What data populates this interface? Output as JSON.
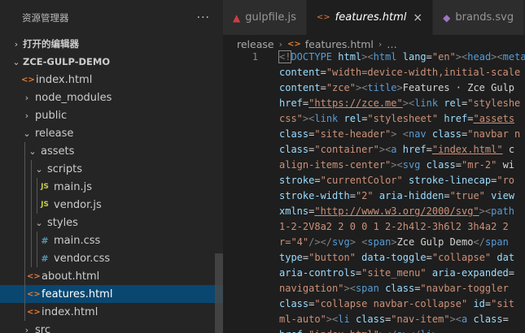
{
  "explorer": {
    "title": "资源管理器",
    "more": "···",
    "open_editors": "打开的编辑器",
    "project": "ZCE-GULP-DEMO",
    "tree": [
      {
        "label": "index.html",
        "icon": "<>",
        "type": "html",
        "depth": 1
      },
      {
        "label": "node_modules",
        "chev": "›",
        "depth": 1
      },
      {
        "label": "public",
        "chev": "›",
        "depth": 1
      },
      {
        "label": "release",
        "chev": "⌄",
        "depth": 1
      },
      {
        "label": "assets",
        "chev": "⌄",
        "depth": 2
      },
      {
        "label": "scripts",
        "chev": "⌄",
        "depth": 3
      },
      {
        "label": "main.js",
        "icon": "JS",
        "type": "js",
        "depth": 4
      },
      {
        "label": "vendor.js",
        "icon": "JS",
        "type": "js",
        "depth": 4
      },
      {
        "label": "styles",
        "chev": "⌄",
        "depth": 3
      },
      {
        "label": "main.css",
        "icon": "#",
        "type": "css",
        "depth": 4
      },
      {
        "label": "vendor.css",
        "icon": "#",
        "type": "css",
        "depth": 4
      },
      {
        "label": "about.html",
        "icon": "<>",
        "type": "html",
        "depth": 2
      },
      {
        "label": "features.html",
        "icon": "<>",
        "type": "html",
        "depth": 2,
        "selected": true
      },
      {
        "label": "index.html",
        "icon": "<>",
        "type": "html",
        "depth": 2
      },
      {
        "label": "src",
        "chev": "›",
        "depth": 1
      }
    ]
  },
  "tabs": [
    {
      "label": "gulpfile.js",
      "icon": "gulp-icon",
      "glyph": "▲",
      "active": false
    },
    {
      "label": "features.html",
      "icon": "html-icon",
      "glyph": "<>",
      "active": true,
      "close": "×"
    },
    {
      "label": "brands.svg",
      "icon": "svg-icon",
      "glyph": "◆",
      "active": false
    }
  ],
  "breadcrumb": {
    "folder": "release",
    "file": "features.html",
    "more": "…",
    "sep": "›"
  },
  "code": {
    "line_number": "1",
    "lines": [
      [
        [
          "p",
          "<!"
        ],
        [
          "t",
          "DOCTYPE "
        ],
        [
          "a",
          "html"
        ],
        [
          "p",
          ">"
        ],
        [
          "p",
          "<"
        ],
        [
          "t",
          "html "
        ],
        [
          "a",
          "lang"
        ],
        [
          "x",
          "="
        ],
        [
          "s",
          "\"en\""
        ],
        [
          "p",
          ">"
        ],
        [
          "p",
          "<"
        ],
        [
          "t",
          "head"
        ],
        [
          "p",
          ">"
        ],
        [
          "p",
          "<"
        ],
        [
          "t",
          "meta"
        ]
      ],
      [
        [
          "a",
          "content"
        ],
        [
          "x",
          "="
        ],
        [
          "s",
          "\"width=device-width,initial-scale"
        ]
      ],
      [
        [
          "a",
          "content"
        ],
        [
          "x",
          "="
        ],
        [
          "s",
          "\"zce\""
        ],
        [
          "p",
          ">"
        ],
        [
          "p",
          "<"
        ],
        [
          "t",
          "title"
        ],
        [
          "p",
          ">"
        ],
        [
          "x",
          "Features · Zce Gulp"
        ]
      ],
      [
        [
          "a",
          "href"
        ],
        [
          "x",
          "="
        ],
        [
          "u",
          "\"https://zce.me\""
        ],
        [
          "p",
          ">"
        ],
        [
          "p",
          "<"
        ],
        [
          "t",
          "link "
        ],
        [
          "a",
          "rel"
        ],
        [
          "x",
          "="
        ],
        [
          "s",
          "\"styleshe"
        ]
      ],
      [
        [
          "s",
          "css\""
        ],
        [
          "p",
          ">"
        ],
        [
          "p",
          "<"
        ],
        [
          "t",
          "link "
        ],
        [
          "a",
          "rel"
        ],
        [
          "x",
          "="
        ],
        [
          "s",
          "\"stylesheet\" "
        ],
        [
          "a",
          "href"
        ],
        [
          "x",
          "="
        ],
        [
          "u",
          "\"assets"
        ]
      ],
      [
        [
          "a",
          "class"
        ],
        [
          "x",
          "="
        ],
        [
          "s",
          "\"site-header\""
        ],
        [
          "p",
          "> <"
        ],
        [
          "t",
          "nav "
        ],
        [
          "a",
          "class"
        ],
        [
          "x",
          "="
        ],
        [
          "s",
          "\"navbar n"
        ]
      ],
      [
        [
          "a",
          "class"
        ],
        [
          "x",
          "="
        ],
        [
          "s",
          "\"container\""
        ],
        [
          "p",
          "><"
        ],
        [
          "t",
          "a "
        ],
        [
          "a",
          "href"
        ],
        [
          "x",
          "="
        ],
        [
          "u",
          "\"index.html\""
        ],
        [
          "x",
          " c"
        ]
      ],
      [
        [
          "s",
          "align-items-center\""
        ],
        [
          "p",
          "><"
        ],
        [
          "t",
          "svg "
        ],
        [
          "a",
          "class"
        ],
        [
          "x",
          "="
        ],
        [
          "s",
          "\"mr-2\""
        ],
        [
          "x",
          " wi"
        ]
      ],
      [
        [
          "a",
          "stroke"
        ],
        [
          "x",
          "="
        ],
        [
          "s",
          "\"currentColor\" "
        ],
        [
          "a",
          "stroke-linecap"
        ],
        [
          "x",
          "="
        ],
        [
          "s",
          "\"ro"
        ]
      ],
      [
        [
          "a",
          "stroke-width"
        ],
        [
          "x",
          "="
        ],
        [
          "s",
          "\"2\" "
        ],
        [
          "a",
          "aria-hidden"
        ],
        [
          "x",
          "="
        ],
        [
          "s",
          "\"true\" "
        ],
        [
          "a",
          "view"
        ]
      ],
      [
        [
          "a",
          "xmlns"
        ],
        [
          "x",
          "="
        ],
        [
          "u",
          "\"http://www.w3.org/2000/svg\""
        ],
        [
          "p",
          "><"
        ],
        [
          "t",
          "path"
        ]
      ],
      [
        [
          "s",
          "1-2-2V8a2 2 0 0 1 2-2h4l2-3h6l2 3h4a2 2"
        ]
      ],
      [
        [
          "s",
          "r=\"4\""
        ],
        [
          "p",
          "/></"
        ],
        [
          "t",
          "svg"
        ],
        [
          "p",
          ">"
        ],
        [
          "x",
          " "
        ],
        [
          "p",
          "<"
        ],
        [
          "t",
          "span"
        ],
        [
          "p",
          ">"
        ],
        [
          "x",
          "Zce Gulp Demo"
        ],
        [
          "p",
          "</"
        ],
        [
          "t",
          "span"
        ]
      ],
      [
        [
          "a",
          "type"
        ],
        [
          "x",
          "="
        ],
        [
          "s",
          "\"button\" "
        ],
        [
          "a",
          "data-toggle"
        ],
        [
          "x",
          "="
        ],
        [
          "s",
          "\"collapse\" "
        ],
        [
          "a",
          "dat"
        ]
      ],
      [
        [
          "a",
          "aria-controls"
        ],
        [
          "x",
          "="
        ],
        [
          "s",
          "\"site_menu\" "
        ],
        [
          "a",
          "aria-expanded"
        ],
        [
          "x",
          "="
        ]
      ],
      [
        [
          "s",
          "navigation\""
        ],
        [
          "p",
          "><"
        ],
        [
          "t",
          "span "
        ],
        [
          "a",
          "class"
        ],
        [
          "x",
          "="
        ],
        [
          "s",
          "\"navbar-toggler"
        ]
      ],
      [
        [
          "a",
          "class"
        ],
        [
          "x",
          "="
        ],
        [
          "s",
          "\"collapse navbar-collapse\" "
        ],
        [
          "a",
          "id"
        ],
        [
          "x",
          "="
        ],
        [
          "s",
          "\"sit"
        ]
      ],
      [
        [
          "s",
          "ml-auto\""
        ],
        [
          "p",
          "><"
        ],
        [
          "t",
          "li "
        ],
        [
          "a",
          "class"
        ],
        [
          "x",
          "="
        ],
        [
          "s",
          "\"nav-item\""
        ],
        [
          "p",
          "><"
        ],
        [
          "t",
          "a "
        ],
        [
          "a",
          "class"
        ],
        [
          "x",
          "="
        ]
      ],
      [
        [
          "a",
          "href"
        ],
        [
          "x",
          "="
        ],
        [
          "s",
          "\"index.html\""
        ],
        [
          "p",
          "></"
        ],
        [
          "t",
          "a"
        ],
        [
          "p",
          "></"
        ],
        [
          "t",
          "li"
        ],
        [
          "p",
          ">"
        ]
      ]
    ]
  }
}
